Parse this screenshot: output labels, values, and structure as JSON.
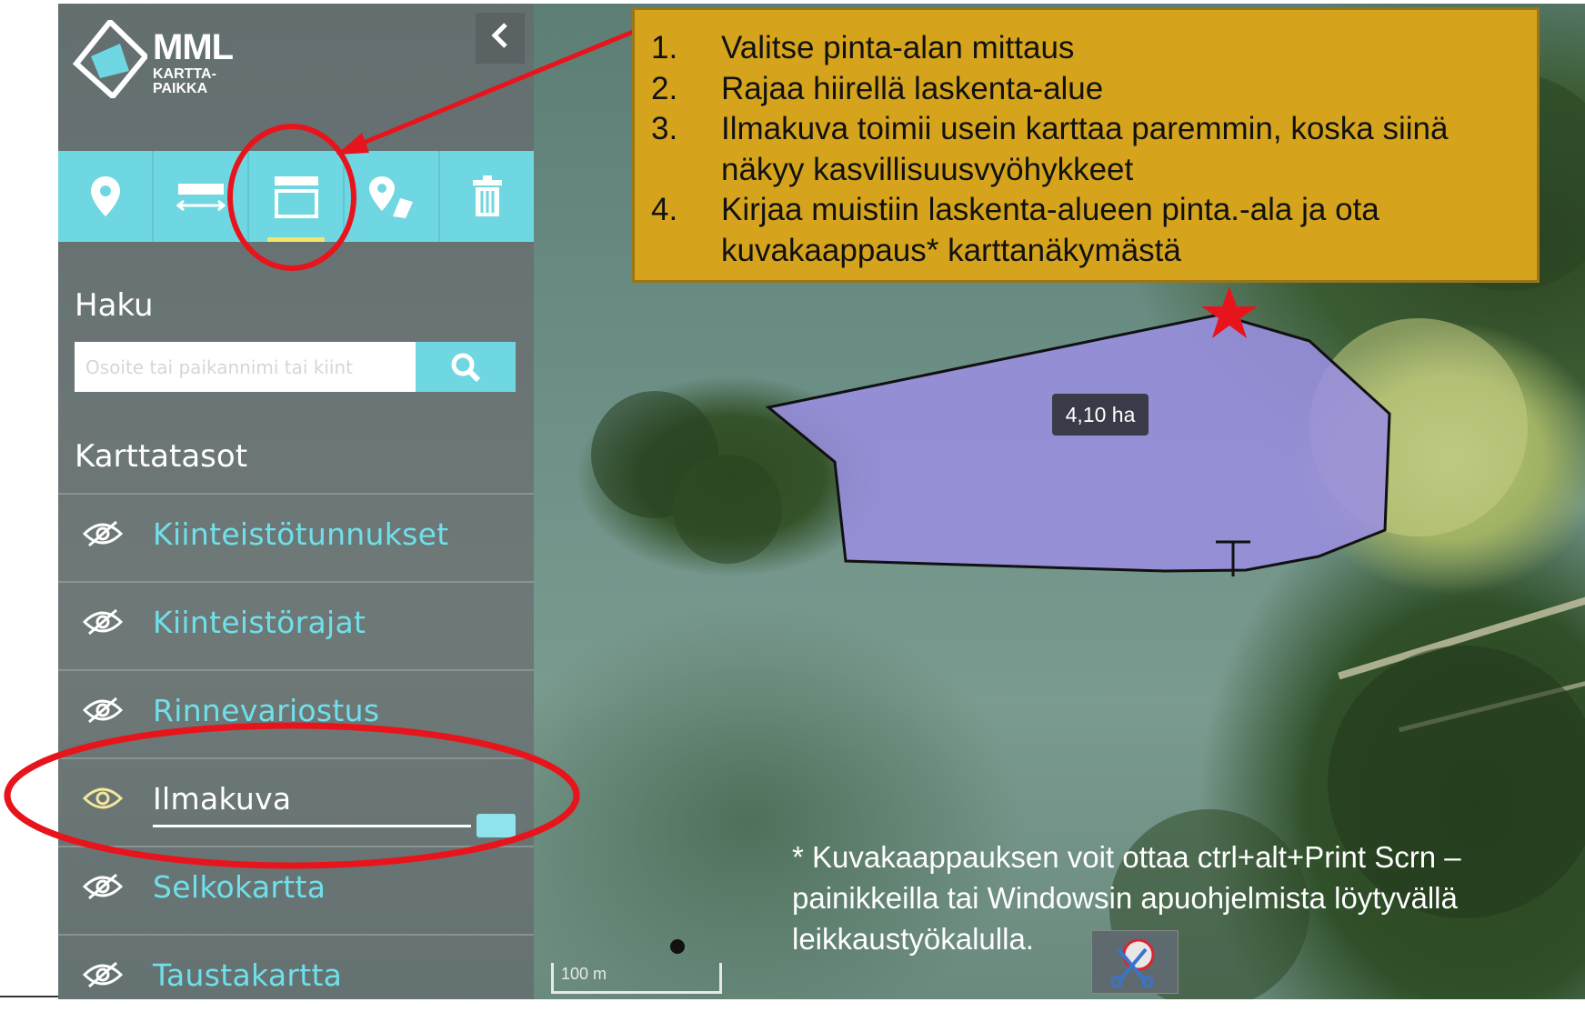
{
  "app": {
    "logo_text": "MML",
    "logo_sub1": "KARTTA-",
    "logo_sub2": "PAIKKA"
  },
  "sidebar": {
    "collapse_icon": "chevron-left-icon",
    "tools": [
      {
        "name": "marker-tool",
        "icon": "map-pin-icon"
      },
      {
        "name": "distance-tool",
        "icon": "ruler-icon"
      },
      {
        "name": "area-tool",
        "icon": "area-measure-icon",
        "active": true
      },
      {
        "name": "locate-tool",
        "icon": "location-edit-icon"
      },
      {
        "name": "delete-tool",
        "icon": "trash-icon"
      }
    ],
    "search_title": "Haku",
    "search_placeholder": "Osoite tai paikannimi tai kiint",
    "layers_title": "Karttatasot",
    "layers": [
      {
        "label": "Kiinteistötunnukset",
        "visible": false
      },
      {
        "label": "Kiinteistörajat",
        "visible": false
      },
      {
        "label": "Rinnevariostus",
        "visible": false
      },
      {
        "label": "Ilmakuva",
        "visible": true,
        "opacity": 1.0
      },
      {
        "label": "Selkokartta",
        "visible": false
      },
      {
        "label": "Taustakartta",
        "visible": false
      }
    ]
  },
  "callout": {
    "items": [
      {
        "num": "1.",
        "text": "Valitse pinta-alan mittaus"
      },
      {
        "num": "2.",
        "text": "Rajaa hiirellä laskenta-alue"
      },
      {
        "num": "3.",
        "text": "Ilmakuva toimii usein karttaa paremmin, koska siinä näkyy kasvillisuusvyöhykkeet"
      },
      {
        "num": "4.",
        "text": "Kirjaa muistiin laskenta-alueen pinta.-ala ja ota kuvakaappaus* karttanäkymästä"
      }
    ]
  },
  "map": {
    "area_label": "4,10 ha",
    "scale_label": "100 m",
    "footnote": "* Kuvakaappauksen voit ottaa  ctrl+alt+Print Scrn –painikkeilla tai Windowsin apuohjelmista löytyvällä leikkaustyökalulla."
  },
  "colors": {
    "accent": "#6fd7e1",
    "annotation_red": "#e8141c",
    "callout_bg": "#d5a41c",
    "polygon_fill": "#9a8ee0"
  }
}
